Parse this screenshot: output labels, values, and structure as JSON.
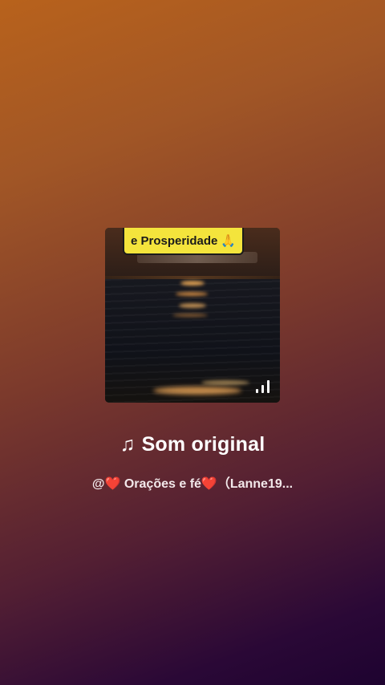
{
  "cover": {
    "caption_text": "e Prosperidade",
    "caption_emoji": "🙏",
    "playing_indicator_icon": "equalizer-bars-icon"
  },
  "sound": {
    "note_icon": "♫",
    "title": "Som original",
    "author": "@❤️ Orações e fé❤️（Lanne19..."
  },
  "colors": {
    "background_top": "#b8621c",
    "background_bottom": "#1e0330",
    "caption_background": "#f4e43c"
  }
}
